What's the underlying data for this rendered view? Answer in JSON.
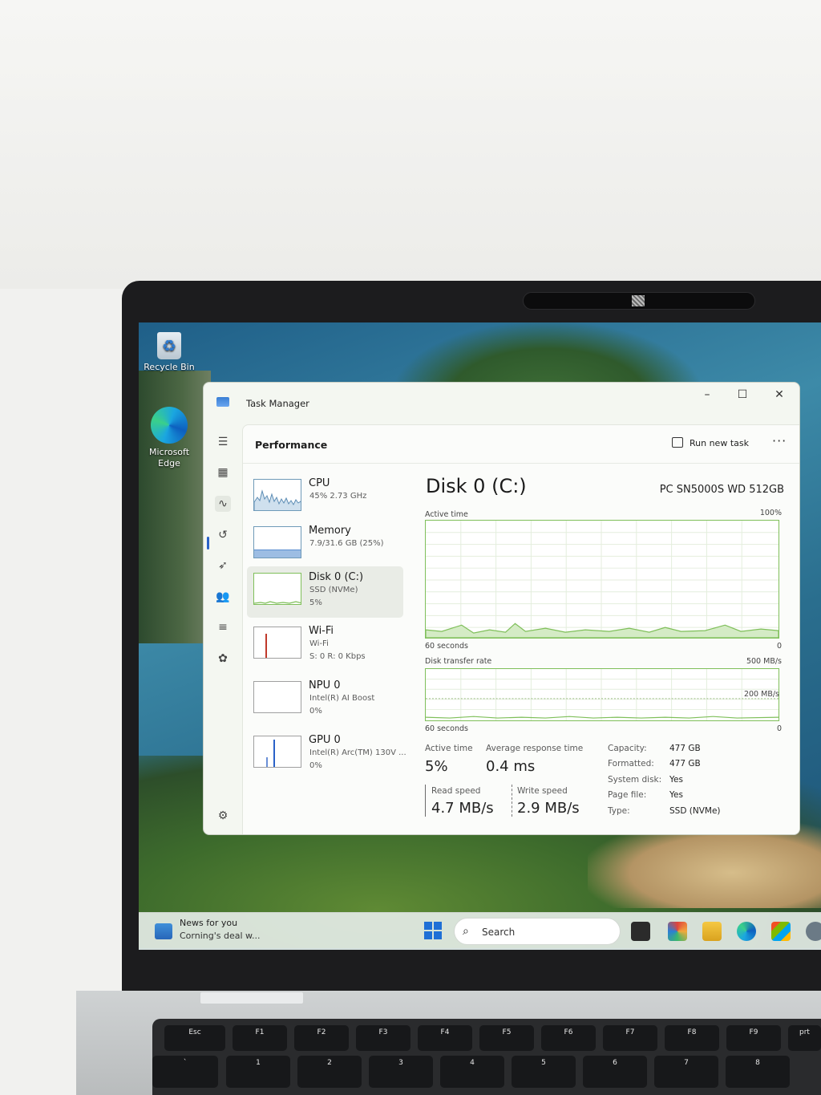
{
  "desktop": {
    "icons": [
      {
        "label": "Recycle Bin",
        "icon": "recycle-bin-icon"
      },
      {
        "label": "Microsoft Edge",
        "icon": "edge-icon"
      }
    ]
  },
  "window": {
    "title": "Task Manager",
    "controls": {
      "minimize": "–",
      "maximize": "☐",
      "close": "✕"
    }
  },
  "header": {
    "title": "Performance",
    "run_new_task": "Run new task",
    "more": "···"
  },
  "perf_items": [
    {
      "name": "CPU",
      "sub1": "45% 2.73 GHz",
      "sub2": "",
      "selected": false
    },
    {
      "name": "Memory",
      "sub1": "7.9/31.6 GB (25%)",
      "sub2": "",
      "selected": false
    },
    {
      "name": "Disk 0 (C:)",
      "sub1": "SSD (NVMe)",
      "sub2": "5%",
      "selected": true
    },
    {
      "name": "Wi-Fi",
      "sub1": "Wi-Fi",
      "sub2": "S: 0 R: 0 Kbps",
      "selected": false
    },
    {
      "name": "NPU 0",
      "sub1": "Intel(R) AI Boost",
      "sub2": "0%",
      "selected": false
    },
    {
      "name": "GPU 0",
      "sub1": "Intel(R) Arc(TM) 130V ...",
      "sub2": "0%",
      "selected": false
    }
  ],
  "detail": {
    "title": "Disk 0 (C:)",
    "model": "PC SN5000S WD 512GB",
    "graph1": {
      "label": "Active time",
      "max": "100%",
      "time": "60 seconds",
      "min": "0"
    },
    "graph2": {
      "label": "Disk transfer rate",
      "max": "500 MB/s",
      "mid": "200 MB/s",
      "time": "60 seconds",
      "min": "0"
    },
    "stats": {
      "active_time_label": "Active time",
      "active_time": "5%",
      "avg_response_label": "Average response time",
      "avg_response": "0.4 ms",
      "read_speed_label": "Read speed",
      "read_speed": "4.7 MB/s",
      "write_speed_label": "Write speed",
      "write_speed": "2.9 MB/s"
    },
    "info": [
      {
        "k": "Capacity:",
        "v": "477 GB"
      },
      {
        "k": "Formatted:",
        "v": "477 GB"
      },
      {
        "k": "System disk:",
        "v": "Yes"
      },
      {
        "k": "Page file:",
        "v": "Yes"
      },
      {
        "k": "Type:",
        "v": "SSD (NVMe)"
      }
    ]
  },
  "taskbar": {
    "news_title": "News for you",
    "news_sub": "Corning's deal w...",
    "search_placeholder": "Search",
    "search_icon": "⌕"
  },
  "keyboard": {
    "row1": [
      "Esc",
      "F1",
      "F2",
      "F3",
      "F4",
      "F5",
      "F6",
      "F7",
      "F8",
      "F9",
      "prt"
    ],
    "row2": [
      "`",
      "1",
      "2",
      "3",
      "4",
      "5",
      "6",
      "7",
      "8"
    ]
  },
  "colors": {
    "accent": "#2a62c8",
    "disk_green": "#7fbf5a",
    "memory_blue": "#5b8fd0",
    "wifi_red": "#c0392b",
    "gpu_blue": "#2a62c8"
  }
}
